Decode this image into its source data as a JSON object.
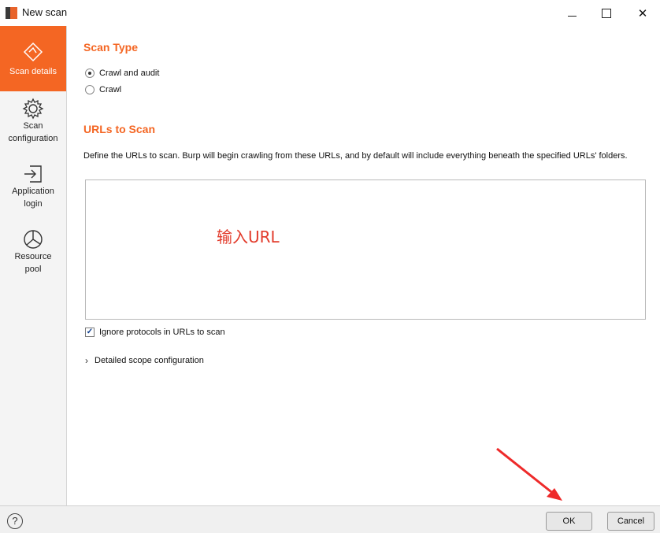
{
  "window": {
    "title": "New scan",
    "minimize_icon": "minimize-icon",
    "maximize_icon": "maximize-icon",
    "close_label": "✕"
  },
  "sidebar": {
    "items": [
      {
        "label": "Scan details",
        "icon": "target-icon",
        "active": true
      },
      {
        "label": "Scan configuration",
        "label_lines": [
          "Scan",
          "configuration"
        ],
        "icon": "gear-icon"
      },
      {
        "label": "Application login",
        "label_lines": [
          "Application",
          "login"
        ],
        "icon": "login-icon"
      },
      {
        "label": "Resource pool",
        "label_lines": [
          "Resource",
          "pool"
        ],
        "icon": "pie-chart-icon"
      }
    ]
  },
  "scan_type": {
    "title": "Scan Type",
    "options": [
      {
        "label": "Crawl and audit",
        "selected": true
      },
      {
        "label": "Crawl",
        "selected": false
      }
    ]
  },
  "urls": {
    "title": "URLs to Scan",
    "description": "Define the URLs to scan. Burp will begin crawling from these URLs, and by default will include everything beneath the specified URLs' folders.",
    "value": "",
    "annotation": "输入URL",
    "ignore_protocols": {
      "label": "Ignore protocols in URLs to scan",
      "checked": true
    },
    "detailed_scope": {
      "label": "Detailed scope configuration"
    }
  },
  "footer": {
    "help_label": "?",
    "ok_label": "OK",
    "cancel_label": "Cancel"
  },
  "colors": {
    "accent": "#f46623",
    "annotation": "#e23a2a"
  }
}
